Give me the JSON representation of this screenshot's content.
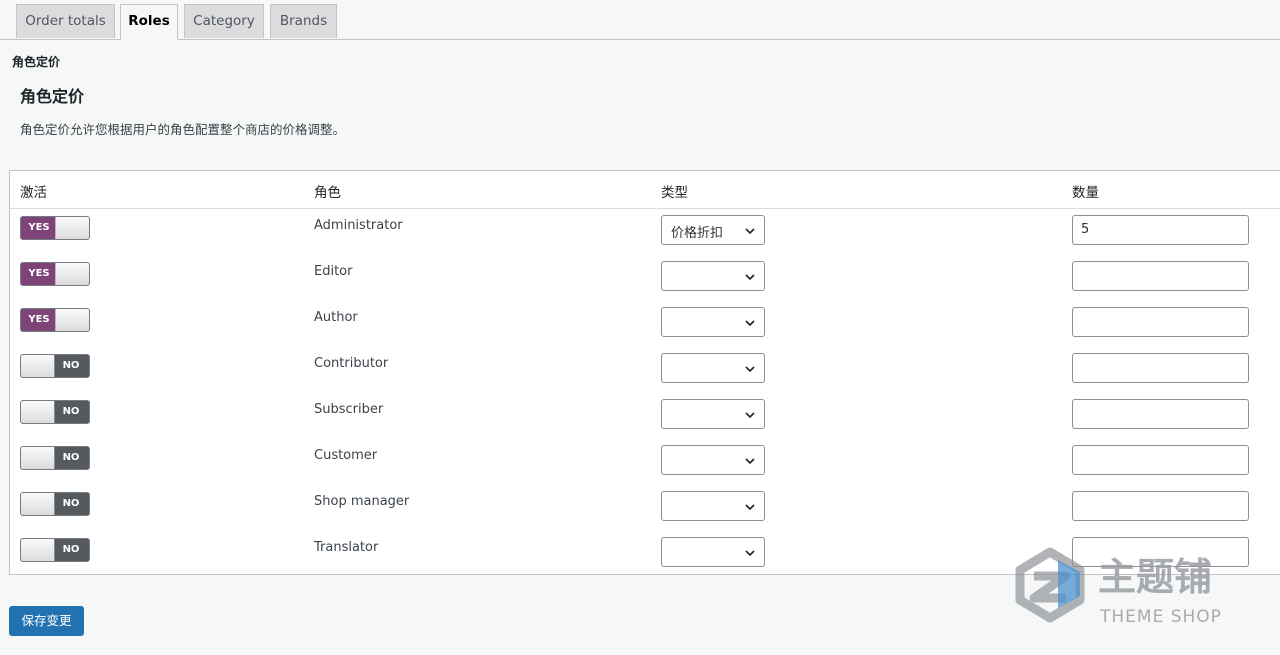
{
  "tabs": [
    {
      "label": "Order totals"
    },
    {
      "label": "Roles"
    },
    {
      "label": "Category"
    },
    {
      "label": "Brands"
    }
  ],
  "active_tab": "Roles",
  "breadcrumb": "角色定价",
  "page_title": "角色定价",
  "description": "角色定价允许您根据用户的角色配置整个商店的价格调整。",
  "table": {
    "headers": {
      "active": "激活",
      "role": "角色",
      "type": "类型",
      "amount": "数量"
    },
    "rows": [
      {
        "active": "YES",
        "role": "Administrator",
        "type": "价格折扣",
        "amount": "5"
      },
      {
        "active": "YES",
        "role": "Editor",
        "type": "",
        "amount": ""
      },
      {
        "active": "YES",
        "role": "Author",
        "type": "",
        "amount": ""
      },
      {
        "active": "NO",
        "role": "Contributor",
        "type": "",
        "amount": ""
      },
      {
        "active": "NO",
        "role": "Subscriber",
        "type": "",
        "amount": ""
      },
      {
        "active": "NO",
        "role": "Customer",
        "type": "",
        "amount": ""
      },
      {
        "active": "NO",
        "role": "Shop manager",
        "type": "",
        "amount": ""
      },
      {
        "active": "NO",
        "role": "Translator",
        "type": "",
        "amount": ""
      }
    ]
  },
  "save_label": "保存变更",
  "watermark": {
    "brand": "主题铺",
    "sub": "THEME SHOP"
  },
  "colors": {
    "toggle_on": "#7e4477",
    "toggle_off": "#555a5f",
    "primary_button": "#2271b1"
  },
  "icons": {
    "select_arrow": "chevron-down-icon",
    "watermark_logo": "theme-shop-logo-icon"
  }
}
